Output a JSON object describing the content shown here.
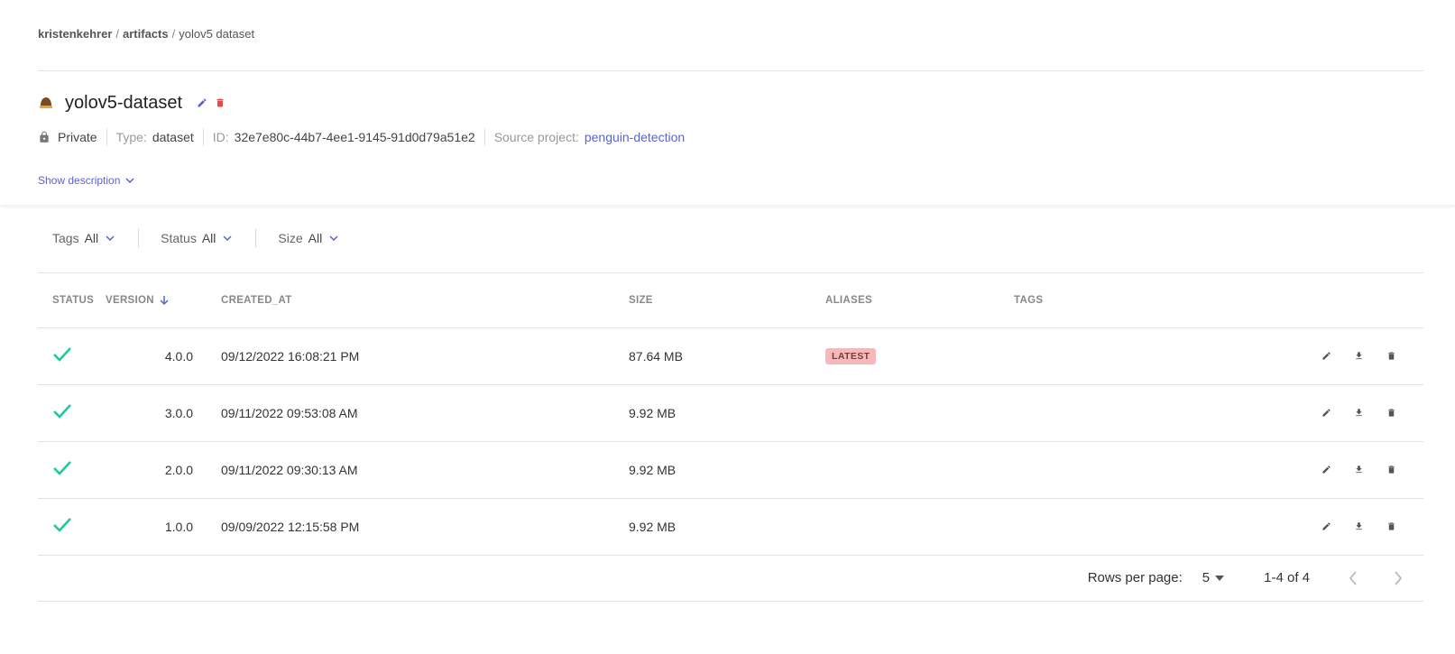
{
  "breadcrumb": {
    "user": "kristenkehrer",
    "section": "artifacts",
    "current": "yolov5 dataset"
  },
  "artifact": {
    "name": "yolov5-dataset",
    "visibility": "Private",
    "type_label": "Type:",
    "type": "dataset",
    "id_label": "ID:",
    "id": "32e7e80c-44b7-4ee1-9145-91d0d79a51e2",
    "source_label": "Source project:",
    "source_project": "penguin-detection",
    "show_description": "Show description"
  },
  "filters": [
    {
      "label": "Tags",
      "value": "All"
    },
    {
      "label": "Status",
      "value": "All"
    },
    {
      "label": "Size",
      "value": "All"
    }
  ],
  "table": {
    "columns": {
      "status": "STATUS",
      "version": "VERSION",
      "created_at": "CREATED_AT",
      "size": "SIZE",
      "aliases": "ALIASES",
      "tags": "TAGS"
    },
    "rows": [
      {
        "version": "4.0.0",
        "created_at": "09/12/2022 16:08:21 PM",
        "size": "87.64 MB",
        "alias": "LATEST"
      },
      {
        "version": "3.0.0",
        "created_at": "09/11/2022 09:53:08 AM",
        "size": "9.92 MB",
        "alias": ""
      },
      {
        "version": "2.0.0",
        "created_at": "09/11/2022 09:30:13 AM",
        "size": "9.92 MB",
        "alias": ""
      },
      {
        "version": "1.0.0",
        "created_at": "09/09/2022 12:15:58 PM",
        "size": "9.92 MB",
        "alias": ""
      }
    ]
  },
  "pagination": {
    "rows_per_page_label": "Rows per page:",
    "rows_per_page": "5",
    "range": "1-4 of 4"
  },
  "colors": {
    "accent": "#5a63d3",
    "success": "#1ec9a0",
    "danger": "#e5484d",
    "badge_bg": "#f6b9ba"
  }
}
